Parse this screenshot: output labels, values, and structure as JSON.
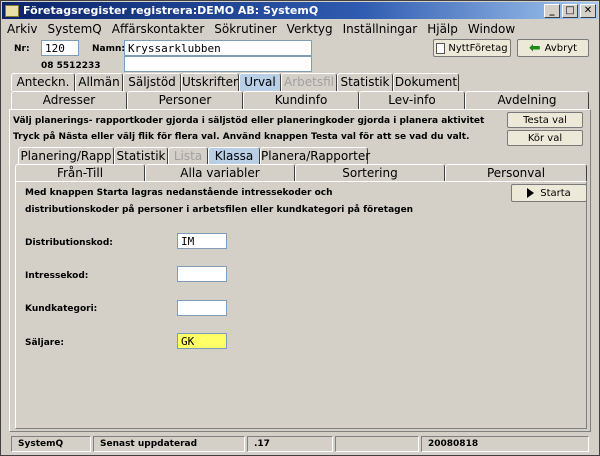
{
  "window": {
    "title": "Företagsregister registrera:DEMO AB: SystemQ"
  },
  "menu": [
    {
      "label": "Arkiv"
    },
    {
      "label": "SystemQ"
    },
    {
      "label": "Affärskontakter"
    },
    {
      "label": "Sökrutiner"
    },
    {
      "label": "Verktyg"
    },
    {
      "label": "Inställningar"
    },
    {
      "label": "Hjälp"
    },
    {
      "label": "Window"
    }
  ],
  "header": {
    "nr_label": "Nr:",
    "nr_value": "120",
    "phone": "08 5512233",
    "namn_label": "Namn:",
    "namn_value": "Kryssarklubben",
    "namn2_value": "",
    "new_company_button": "NyttFöretag",
    "cancel_button": "Avbryt"
  },
  "main_tabs": [
    {
      "label": "Anteckn."
    },
    {
      "label": "Allmän"
    },
    {
      "label": "Säljstöd"
    },
    {
      "label": "Utskrifter"
    },
    {
      "label": "Urval"
    },
    {
      "label": "Arbetsfil"
    },
    {
      "label": "Statistik"
    },
    {
      "label": "Dokument"
    }
  ],
  "sub_tabs": [
    {
      "label": "Adresser"
    },
    {
      "label": "Personer"
    },
    {
      "label": "Kundinfo"
    },
    {
      "label": "Lev-info"
    },
    {
      "label": "Avdelning"
    }
  ],
  "urval": {
    "info1": "Välj planerings- rapportkoder gjorda i säljstöd eller planeringkoder gjorda i planera aktivitet",
    "info2": "Tryck på Nästa eller välj flik för flera val. Använd knappen Testa val för att se vad du valt.",
    "test_button": "Testa val",
    "run_button": "Kör val"
  },
  "inner_tabs_row1": [
    {
      "label": "Planering/Rapp"
    },
    {
      "label": "Statistik"
    },
    {
      "label": "Lista"
    },
    {
      "label": "Klassa"
    },
    {
      "label": "Planera/Rapporter"
    }
  ],
  "inner_tabs_row2": [
    {
      "label": "Från-Till"
    },
    {
      "label": "Alla variabler"
    },
    {
      "label": "Sortering"
    },
    {
      "label": "Personval"
    }
  ],
  "klassa": {
    "desc1": "Med knappen Starta lagras nedanstående intressekoder och",
    "desc2": "distributionskoder på personer i arbetsfilen eller kundkategori på företagen",
    "start_button": "Starta",
    "dist_label": "Distributionskod:",
    "dist_value": "IM",
    "intr_label": "Intressekod:",
    "intr_value": "",
    "kund_label": "Kundkategori:",
    "kund_value": "",
    "salj_label": "Säljare:",
    "salj_value": "GK",
    "highlight_color": "#ffff66"
  },
  "status": {
    "app": "SystemQ",
    "updated": "Senast uppdaterad",
    "version": ".17",
    "empty": "",
    "date": "20080818"
  }
}
